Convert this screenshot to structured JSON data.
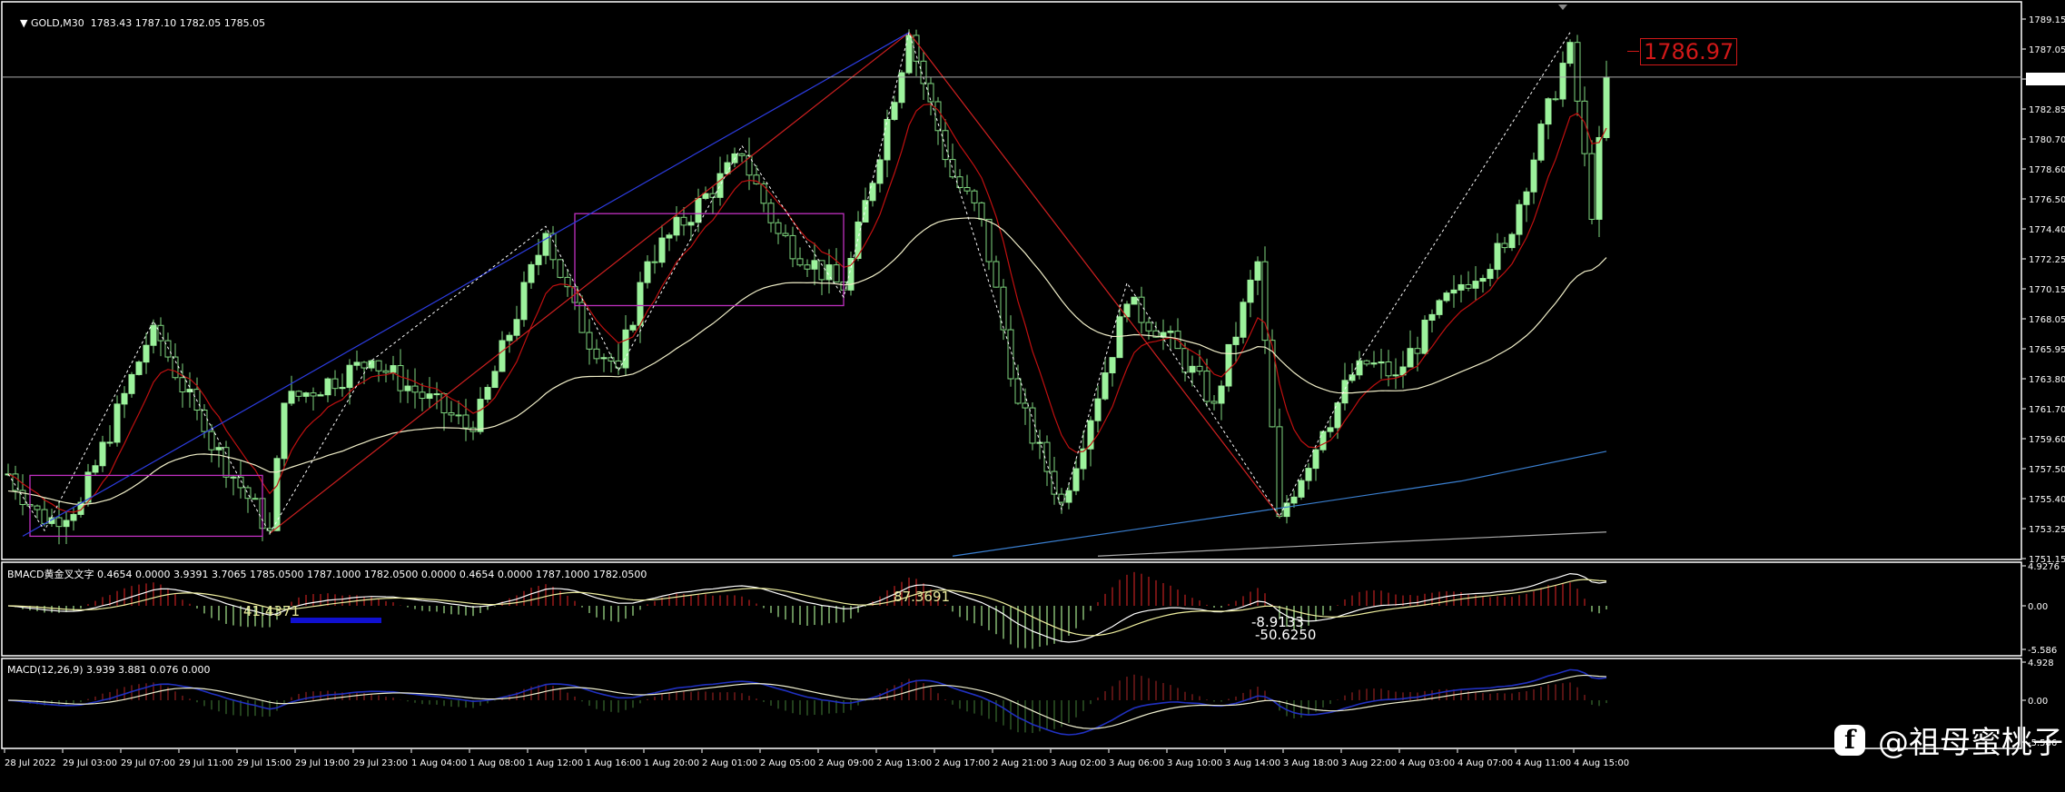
{
  "header": {
    "symbol_label": "GOLD,M30",
    "ohlc": "1783.43 1787.10 1782.05 1785.05"
  },
  "indicator1": {
    "label": "BMACD黄金叉文字 0.4654 0.0000 3.9391 3.7065 1785.0500 1787.1000 1782.0500 0.0000 0.4654 0.0000 1787.1000 1782.0500",
    "scale_max": "4.9276",
    "scale_zero": "0.00",
    "scale_min": "-5.586",
    "annotations": [
      "41.4371",
      "87.3691",
      "-8.9133",
      "-50.6250"
    ]
  },
  "indicator2": {
    "label": "MACD(12,26,9) 3.939 3.881 0.076 0.000",
    "scale_max": "4.928",
    "scale_zero": "0.00",
    "scale_min": "-5.586"
  },
  "price_tag": "1786.97",
  "current_price": "1785.05",
  "watermark": {
    "icon": "facebook-icon",
    "text": "@祖母蜜桃子"
  },
  "colors": {
    "bull": "#9cf29c",
    "bear_outline": "#7fd67f",
    "ma_fast": "#c01010",
    "ma_slow": "#f0eec8",
    "ma_long": "#3a7fd0",
    "zigzag": "#ffffff",
    "box": "#c030c0",
    "tag": "#d01818"
  },
  "chart_data": {
    "type": "candlestick",
    "title": "GOLD,M30",
    "ylim": [
      1751.15,
      1789.15
    ],
    "y_ticks": [
      "1789.15",
      "1787.05",
      "1785.05",
      "1782.85",
      "1780.70",
      "1778.60",
      "1776.50",
      "1774.40",
      "1772.25",
      "1770.15",
      "1768.05",
      "1765.95",
      "1763.80",
      "1761.70",
      "1759.60",
      "1757.50",
      "1755.40",
      "1753.25",
      "1751.15"
    ],
    "x_ticks": [
      "28 Jul 2022",
      "29 Jul 03:00",
      "29 Jul 07:00",
      "29 Jul 11:00",
      "29 Jul 15:00",
      "29 Jul 19:00",
      "29 Jul 23:00",
      "1 Aug 04:00",
      "1 Aug 08:00",
      "1 Aug 12:00",
      "1 Aug 16:00",
      "1 Aug 20:00",
      "2 Aug 01:00",
      "2 Aug 05:00",
      "2 Aug 09:00",
      "2 Aug 13:00",
      "2 Aug 17:00",
      "2 Aug 21:00",
      "3 Aug 02:00",
      "3 Aug 06:00",
      "3 Aug 10:00",
      "3 Aug 14:00",
      "3 Aug 18:00",
      "3 Aug 22:00",
      "4 Aug 03:00",
      "4 Aug 07:00",
      "4 Aug 11:00",
      "4 Aug 15:00"
    ],
    "candles_per_tick": 8,
    "price_path": [
      [
        0,
        1757
      ],
      [
        5,
        1753.5
      ],
      [
        10,
        1755
      ],
      [
        20,
        1767.5
      ],
      [
        27,
        1760
      ],
      [
        36,
        1753
      ],
      [
        38,
        1762
      ],
      [
        50,
        1765
      ],
      [
        64,
        1760
      ],
      [
        74,
        1774
      ],
      [
        79,
        1767
      ],
      [
        84,
        1764.5
      ],
      [
        88,
        1772
      ],
      [
        101,
        1779.5
      ],
      [
        106,
        1774
      ],
      [
        115,
        1770
      ],
      [
        124,
        1788
      ],
      [
        130,
        1778
      ],
      [
        134,
        1775
      ],
      [
        139,
        1762
      ],
      [
        145,
        1755
      ],
      [
        154,
        1769
      ],
      [
        159,
        1767
      ],
      [
        166,
        1762
      ],
      [
        172,
        1772
      ],
      [
        175,
        1754
      ],
      [
        181,
        1760
      ],
      [
        186,
        1765
      ],
      [
        191,
        1764
      ],
      [
        199,
        1770
      ],
      [
        206,
        1773
      ],
      [
        215,
        1787.5
      ],
      [
        218,
        1775
      ],
      [
        220,
        1785
      ]
    ],
    "zigzag": [
      [
        0,
        1757
      ],
      [
        5,
        1753
      ],
      [
        20,
        1767.8
      ],
      [
        36,
        1752.8
      ],
      [
        50,
        1765
      ],
      [
        74,
        1774.5
      ],
      [
        84,
        1764.3
      ],
      [
        101,
        1780.2
      ],
      [
        115,
        1769.5
      ],
      [
        124,
        1788.2
      ],
      [
        145,
        1754.5
      ],
      [
        154,
        1770.5
      ],
      [
        175,
        1754
      ],
      [
        186,
        1765
      ],
      [
        215,
        1788.2
      ]
    ],
    "red_trendlines": [
      [
        [
          36,
          1752.8
        ],
        [
          124,
          1788.2
        ]
      ],
      [
        [
          124,
          1788.2
        ],
        [
          175,
          1754
        ]
      ]
    ],
    "blue_trendline": [
      [
        2,
        1752.6
      ],
      [
        124,
        1788.2
      ]
    ],
    "boxes": [
      {
        "from": 3,
        "to": 35,
        "top": 1756.9,
        "bottom": 1752.6
      },
      {
        "from": 78,
        "to": 115,
        "top": 1775.4,
        "bottom": 1768.9
      }
    ],
    "ma_long": [
      [
        130,
        1751.2
      ],
      [
        170,
        1754.2
      ],
      [
        200,
        1756.5
      ],
      [
        220,
        1758.6
      ]
    ],
    "ma_longer": [
      [
        150,
        1751.2
      ],
      [
        190,
        1752.2
      ],
      [
        220,
        1752.9
      ]
    ],
    "last_price": 1785.05
  }
}
